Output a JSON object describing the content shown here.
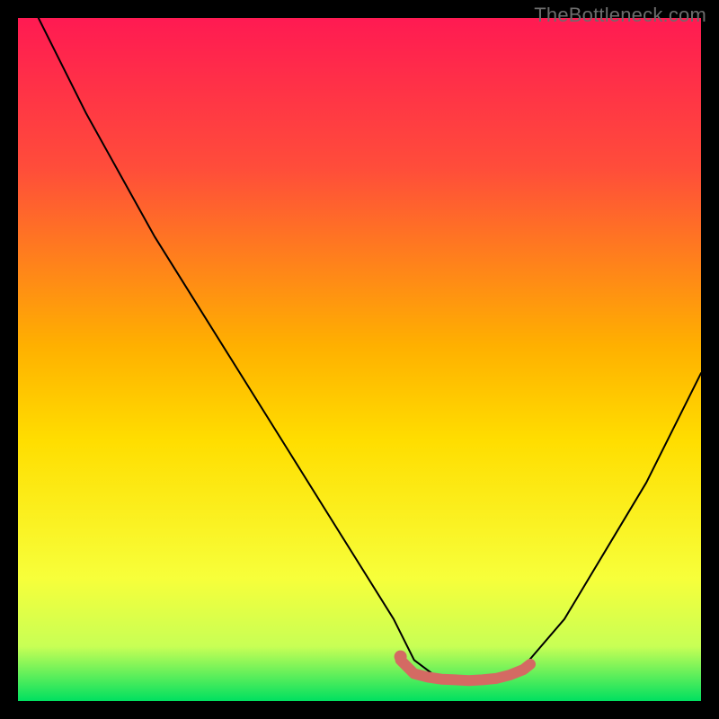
{
  "watermark": "TheBottleneck.com",
  "chart_data": {
    "type": "line",
    "title": "",
    "xlabel": "",
    "ylabel": "",
    "xlim": [
      0,
      100
    ],
    "ylim": [
      0,
      100
    ],
    "grid": false,
    "legend": "none",
    "background_gradient": {
      "top_color": "#ff1a52",
      "mid_color": "#ffde00",
      "bottom_color": "#00e060"
    },
    "series": [
      {
        "name": "bottleneck-curve",
        "type": "line",
        "color": "#000000",
        "x": [
          3,
          10,
          20,
          30,
          40,
          50,
          55,
          58,
          62,
          66,
          70,
          74,
          80,
          86,
          92,
          100
        ],
        "values": [
          100,
          86,
          68,
          52,
          36,
          20,
          12,
          6,
          3,
          3,
          3,
          5,
          12,
          22,
          32,
          48
        ]
      },
      {
        "name": "highlight-band",
        "type": "line",
        "color": "#d46a63",
        "x": [
          56,
          58,
          60,
          62,
          64,
          66,
          68,
          70,
          72,
          74,
          75
        ],
        "values": [
          6,
          4,
          3.5,
          3.2,
          3.1,
          3.0,
          3.1,
          3.3,
          3.8,
          4.6,
          5.4
        ],
        "stroke_width": 12
      },
      {
        "name": "highlight-dot",
        "type": "scatter",
        "color": "#d46a63",
        "x": [
          56
        ],
        "values": [
          6.5
        ],
        "radius": 7
      }
    ]
  }
}
